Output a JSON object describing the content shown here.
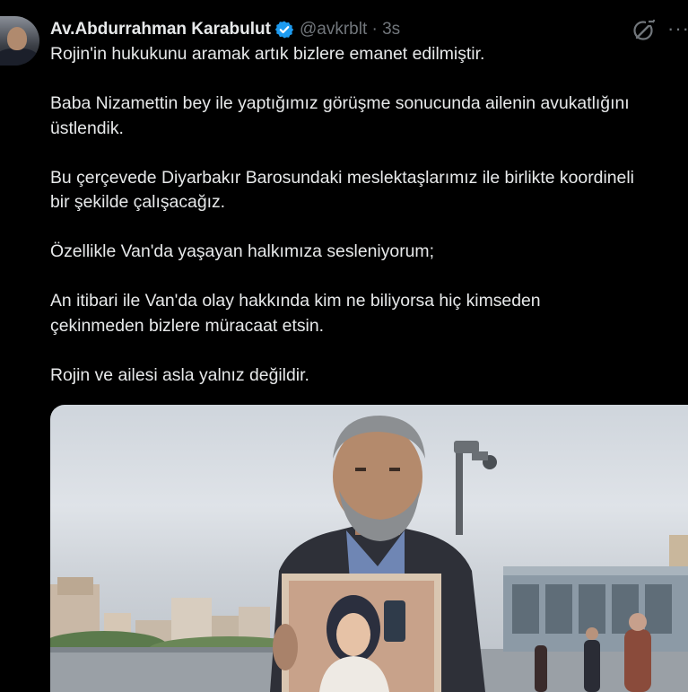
{
  "tweet": {
    "author_name": "Av.Abdurrahman Karabulut",
    "handle_time": "@avkrblt · 3s",
    "verified_color": "#1d9bf0",
    "paragraphs": [
      "Rojin'in hukukunu aramak artık bizlere emanet edilmiştir.",
      "Baba Nizamettin bey ile yaptığımız görüşme sonucunda ailenin avukatlığını\nüstlendik.",
      "Bu çerçevede Diyarbakır Barosundaki meslektaşlarımız ile birlikte koordineli\nbir şekilde çalışacağız.",
      "Özellikle Van'da yaşayan halkımıza sesleniyorum;",
      "An itibari ile Van'da olay hakkında kim ne biliyorsa hiç kimseden\nçekinmeden bizlere müracaat etsin.",
      "Rojin ve ailesi asla yalnız değildir."
    ]
  },
  "icons": {
    "verified": "verified-badge-icon",
    "grok": "grok-icon",
    "more": "more-options-icon"
  }
}
